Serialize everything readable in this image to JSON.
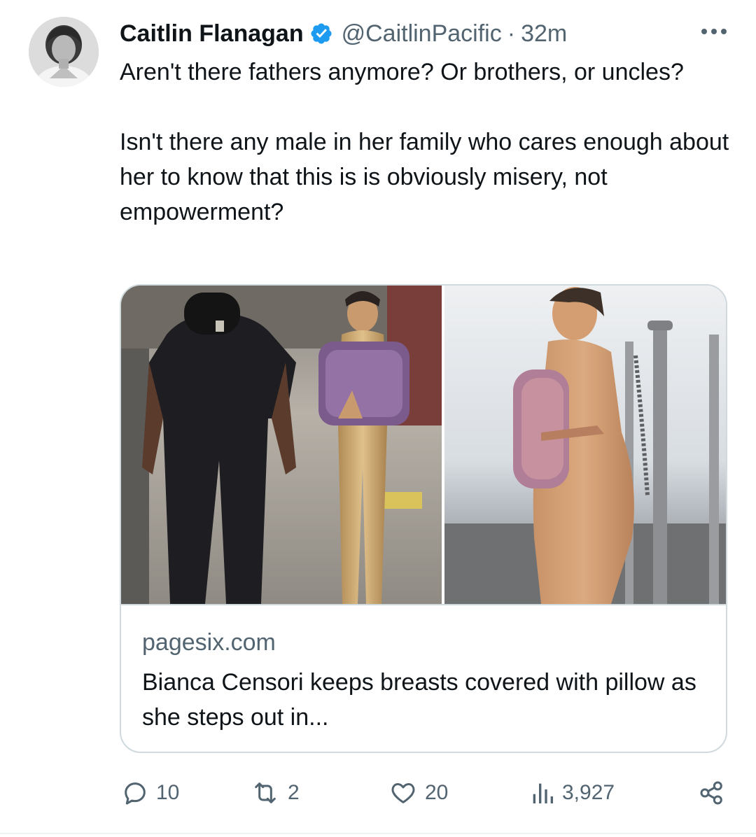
{
  "tweet": {
    "author_name": "Caitlin Flanagan",
    "author_handle": "@CaitlinPacific",
    "separator": "·",
    "timestamp": "32m",
    "verified": true,
    "text_paragraphs": [
      "Aren't there fathers anymore? Or brothers, or uncles?",
      "Isn't there any male in her family who cares enough about her to know that this is is obviously misery, not empowerment?"
    ]
  },
  "link_card": {
    "domain": "pagesix.com",
    "title": "Bianca Censori keeps breasts covered with pillow as she steps out in..."
  },
  "actions": {
    "replies": "10",
    "reposts": "2",
    "likes": "20",
    "views": "3,927"
  },
  "icons": {
    "verified": "verified-badge-icon",
    "more": "more-options-icon",
    "reply": "reply-icon",
    "repost": "repost-icon",
    "like": "heart-icon",
    "views": "views-icon",
    "share": "share-icon"
  },
  "colors": {
    "primary_text": "#0f1419",
    "secondary_text": "#536471",
    "verified_blue": "#1d9bf0",
    "border": "#cfd9de"
  }
}
